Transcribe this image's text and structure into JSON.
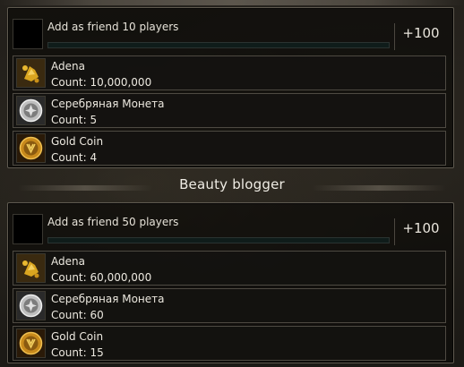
{
  "sections": [
    {
      "quest": {
        "label": "Add as friend 10 players",
        "progress": 0,
        "reward_points": "+100"
      },
      "rewards": [
        {
          "icon": "adena-icon",
          "name": "Adena",
          "count": "Count: 10,000,000"
        },
        {
          "icon": "silver-coin-icon",
          "name": "Серебряная Монета",
          "count": "Count: 5"
        },
        {
          "icon": "gold-coin-icon",
          "name": "Gold Coin",
          "count": "Count: 4"
        }
      ]
    },
    {
      "title": "Beauty blogger",
      "quest": {
        "label": "Add as friend 50 players",
        "progress": 0,
        "reward_points": "+100"
      },
      "rewards": [
        {
          "icon": "adena-icon",
          "name": "Adena",
          "count": "Count: 60,000,000"
        },
        {
          "icon": "silver-coin-icon",
          "name": "Серебряная Монета",
          "count": "Count: 60"
        },
        {
          "icon": "gold-coin-icon",
          "name": "Gold Coin",
          "count": "Count: 15"
        }
      ]
    }
  ],
  "colors": {
    "panel_border": "#5f5a50",
    "progress_fill": "#36534c",
    "text": "#e6e2d8"
  }
}
